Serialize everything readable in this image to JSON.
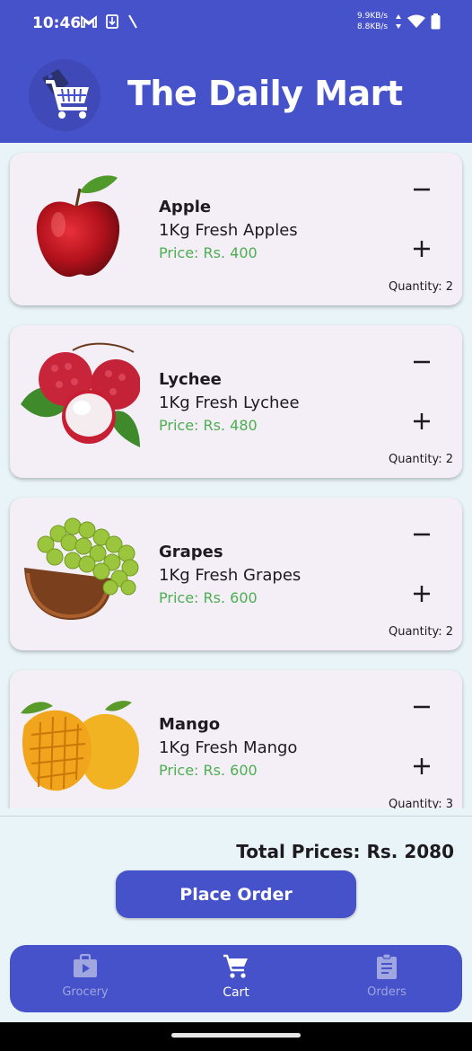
{
  "status": {
    "time": "10:46",
    "net_up": "9.9KB/s",
    "net_down": "8.8KB/s"
  },
  "app": {
    "title": "The Daily Mart"
  },
  "products": [
    {
      "name": "Apple",
      "description": "1Kg Fresh Apples",
      "price": "Price: Rs. 400",
      "quantity": "Quantity: 2"
    },
    {
      "name": "Lychee",
      "description": "1Kg Fresh Lychee",
      "price": "Price: Rs. 480",
      "quantity": "Quantity: 2"
    },
    {
      "name": "Grapes",
      "description": "1Kg Fresh Grapes",
      "price": "Price: Rs. 600",
      "quantity": "Quantity: 2"
    },
    {
      "name": "Mango",
      "description": "1Kg Fresh Mango",
      "price": "Price: Rs. 600",
      "quantity": "Quantity: 3"
    }
  ],
  "summary": {
    "total": "Total Prices: Rs. 2080",
    "place_order": "Place Order"
  },
  "nav": {
    "items": [
      {
        "label": "Grocery",
        "icon": "shopping-bag-icon"
      },
      {
        "label": "Cart",
        "icon": "cart-icon"
      },
      {
        "label": "Orders",
        "icon": "clipboard-icon"
      }
    ],
    "active": "Cart"
  },
  "colors": {
    "primary": "#4652c9",
    "price_green": "#4caf50",
    "card_bg": "#f4eef6",
    "page_bg": "#e8f4f7"
  }
}
